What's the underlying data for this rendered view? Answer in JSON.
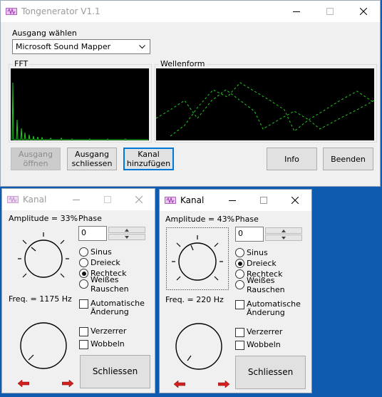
{
  "main": {
    "title": "Tongenerator V1.1",
    "output_label": "Ausgang wählen",
    "output_value": "Microsoft Sound Mapper",
    "fft_label": "FFT",
    "wave_label": "Wellenform",
    "open_btn": "Ausgang\nöffnen",
    "close_btn": "Ausgang\nschliessen",
    "add_btn": "Kanal\nhinzufügen",
    "info_btn": "Info",
    "exit_btn": "Beenden"
  },
  "kanal1": {
    "title": "Kanal",
    "amplitude": "Amplitude = 33%",
    "freq": "Freq. = 1175 Hz",
    "phase_label": "Phase",
    "phase_value": "0",
    "waveforms": [
      "Sinus",
      "Dreieck",
      "Rechteck",
      "Weißes Rauschen"
    ],
    "selected": "Rechteck",
    "auto": "Automatische\nÄnderung",
    "verzerrer": "Verzerrer",
    "wobbeln": "Wobbeln",
    "close_btn": "Schliessen"
  },
  "kanal2": {
    "title": "Kanal",
    "amplitude": "Amplitude = 43%",
    "freq": "Freq. = 220 Hz",
    "phase_label": "Phase",
    "phase_value": "0",
    "waveforms": [
      "Sinus",
      "Dreieck",
      "Rechteck",
      "Weißes Rauschen"
    ],
    "selected": "Dreieck",
    "auto": "Automatische\nÄnderung",
    "verzerrer": "Verzerrer",
    "wobbeln": "Wobbeln",
    "close_btn": "Schliessen"
  },
  "colors": {
    "trace": "#22cc22",
    "desktop": "#0f5bb0",
    "focus": "#0078d7",
    "arrow": "#d42020"
  }
}
